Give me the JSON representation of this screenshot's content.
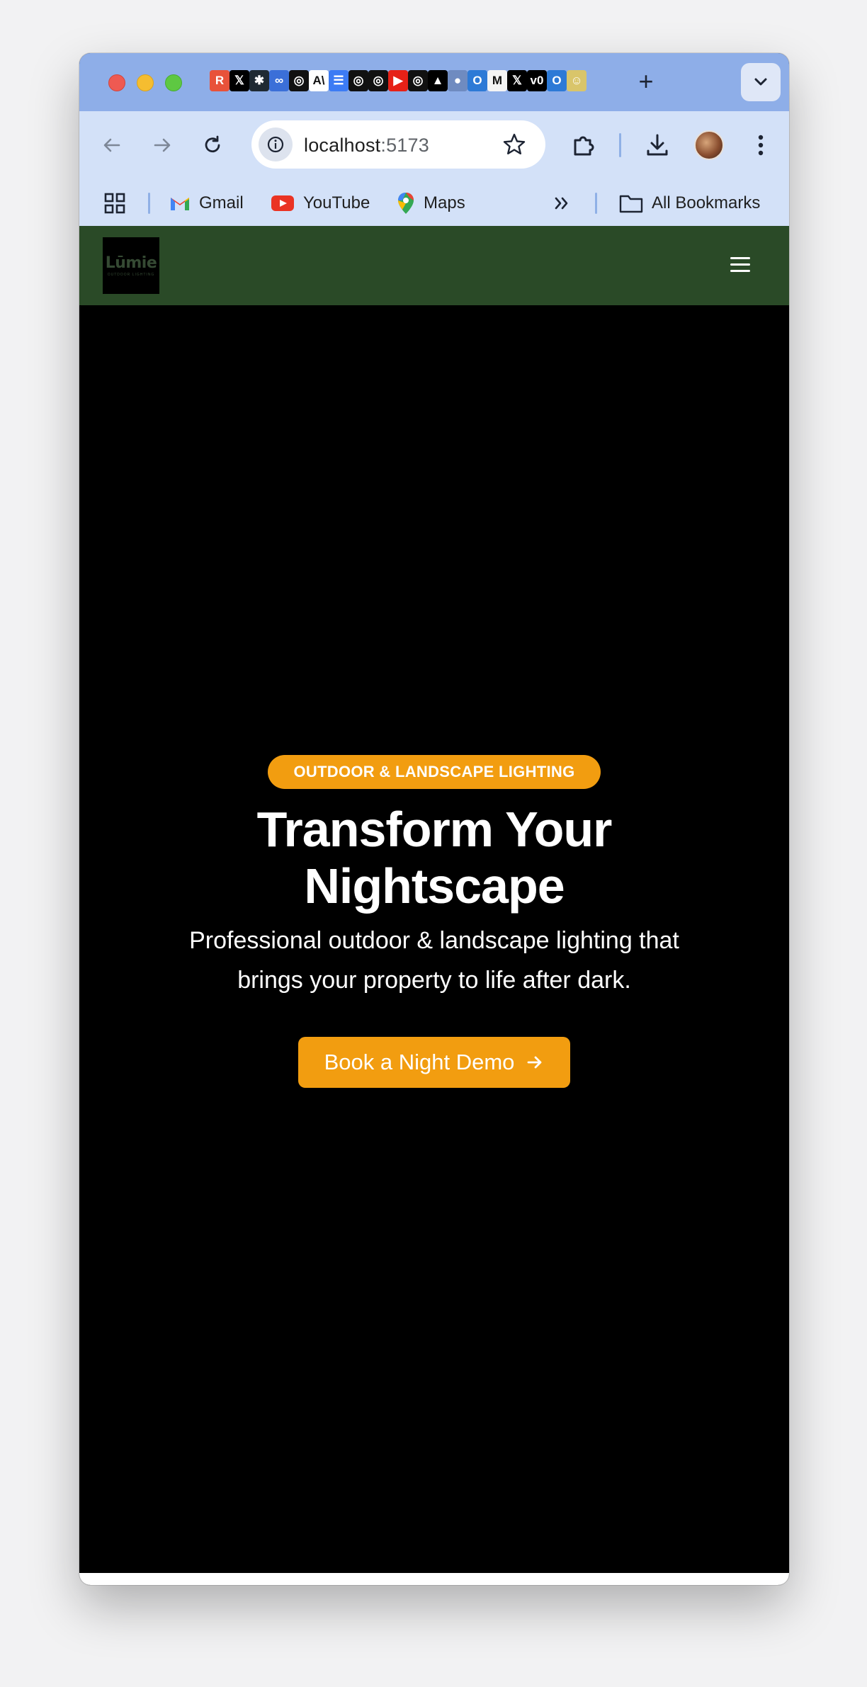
{
  "browser": {
    "favicons": [
      {
        "name": "recraft-icon",
        "glyph": "R",
        "bg": "#e8523a"
      },
      {
        "name": "x-icon",
        "glyph": "𝕏",
        "bg": "#000000"
      },
      {
        "name": "perplexity-icon",
        "glyph": "✱",
        "bg": "#1f2a33"
      },
      {
        "name": "meta-icon",
        "glyph": "∞",
        "bg": "#3b6fd8"
      },
      {
        "name": "chatgpt-icon",
        "glyph": "◎",
        "bg": "#111111"
      },
      {
        "name": "anthropic-icon",
        "glyph": "A\\",
        "bg": "#ffffff"
      },
      {
        "name": "docs-icon",
        "glyph": "☰",
        "bg": "#3c7bf4"
      },
      {
        "name": "chatgpt-icon",
        "glyph": "◎",
        "bg": "#111111"
      },
      {
        "name": "chatgpt-icon",
        "glyph": "◎",
        "bg": "#111111"
      },
      {
        "name": "youtube-icon",
        "glyph": "▶",
        "bg": "#e62117"
      },
      {
        "name": "chatgpt-icon",
        "glyph": "◎",
        "bg": "#111111"
      },
      {
        "name": "vercel-icon",
        "glyph": "▲",
        "bg": "#000000"
      },
      {
        "name": "globe-icon",
        "glyph": "●",
        "bg": "#6f8bc0"
      },
      {
        "name": "outlook-icon",
        "glyph": "O",
        "bg": "#2d7ad6"
      },
      {
        "name": "gmail-icon",
        "glyph": "M",
        "bg": "#f4f4f4"
      },
      {
        "name": "x-icon",
        "glyph": "𝕏",
        "bg": "#000000"
      },
      {
        "name": "v0-icon",
        "glyph": "v0",
        "bg": "#000000"
      },
      {
        "name": "outlook-icon",
        "glyph": "O",
        "bg": "#2d7ad6"
      },
      {
        "name": "avatar-icon",
        "glyph": "☺",
        "bg": "#d9c56a"
      }
    ],
    "url_host": "localhost",
    "url_port": ":5173",
    "bookmarks": [
      {
        "label": "Gmail",
        "icon": "gmail-icon"
      },
      {
        "label": "YouTube",
        "icon": "youtube-icon"
      },
      {
        "label": "Maps",
        "icon": "maps-icon"
      }
    ],
    "all_bookmarks_label": "All Bookmarks"
  },
  "site": {
    "logo_text": "Lūmie",
    "logo_subtext": "OUTDOOR LIGHTING",
    "hero": {
      "badge": "OUTDOOR & LANDSCAPE LIGHTING",
      "headline_line1": "Transform Your",
      "headline_line2": "Nightscape",
      "subtext_line1": "Professional outdoor & landscape lighting that",
      "subtext_line2": "brings your property to life after dark.",
      "cta_label": "Book a Night Demo"
    }
  },
  "colors": {
    "header_bg": "#2a4a27",
    "accent": "#f29d10",
    "tabstrip": "#8eaee8",
    "toolbar": "#d3e1f8"
  }
}
